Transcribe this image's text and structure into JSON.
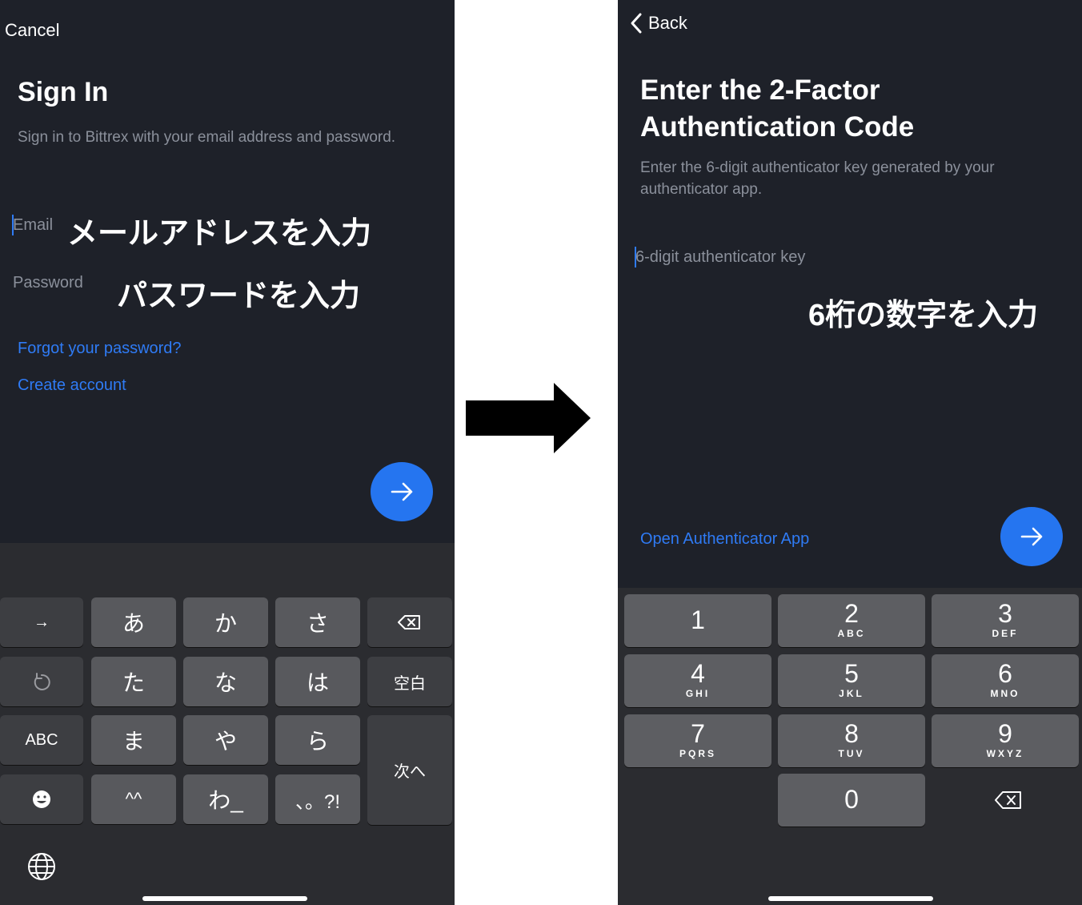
{
  "left_screen": {
    "cancel_label": "Cancel",
    "title": "Sign In",
    "subtitle": "Sign in to Bittrex with your email address and password.",
    "email_placeholder": "Email",
    "password_placeholder": "Password",
    "email_annotation": "メールアドレスを入力",
    "password_annotation": "パスワードを入力",
    "forgot_link": "Forgot your password?",
    "create_link": "Create account",
    "submit_icon": "arrow-right-icon",
    "keyboard": {
      "row1": [
        "→",
        "あ",
        "か",
        "さ",
        "delete"
      ],
      "row2": [
        "undo",
        "た",
        "な",
        "は",
        "空白"
      ],
      "row3": [
        "ABC",
        "ま",
        "や",
        "ら"
      ],
      "row4": [
        "emoji",
        "^^",
        "わ_",
        "、。?!"
      ],
      "next_key": "次へ",
      "globe_icon": "globe-icon"
    }
  },
  "right_screen": {
    "back_label": "Back",
    "title": "Enter the 2-Factor Authentication Code",
    "subtitle": "Enter the 6-digit authenticator key generated by your authenticator app.",
    "key_placeholder": "6-digit authenticator key",
    "annotation": "6桁の数字を入力",
    "open_app_link": "Open Authenticator App",
    "submit_icon": "arrow-right-icon",
    "numpad": [
      {
        "digit": "1",
        "letters": ""
      },
      {
        "digit": "2",
        "letters": "ABC"
      },
      {
        "digit": "3",
        "letters": "DEF"
      },
      {
        "digit": "4",
        "letters": "GHI"
      },
      {
        "digit": "5",
        "letters": "JKL"
      },
      {
        "digit": "6",
        "letters": "MNO"
      },
      {
        "digit": "7",
        "letters": "PQRS"
      },
      {
        "digit": "8",
        "letters": "TUV"
      },
      {
        "digit": "9",
        "letters": "WXYZ"
      },
      {
        "digit": "0",
        "letters": ""
      }
    ]
  },
  "colors": {
    "screen_bg": "#1e2129",
    "accent": "#2f7bf5",
    "fab": "#2575f0",
    "muted_text": "#8b909b",
    "keyboard_bg": "#2b2c30",
    "key": "#58595d"
  }
}
